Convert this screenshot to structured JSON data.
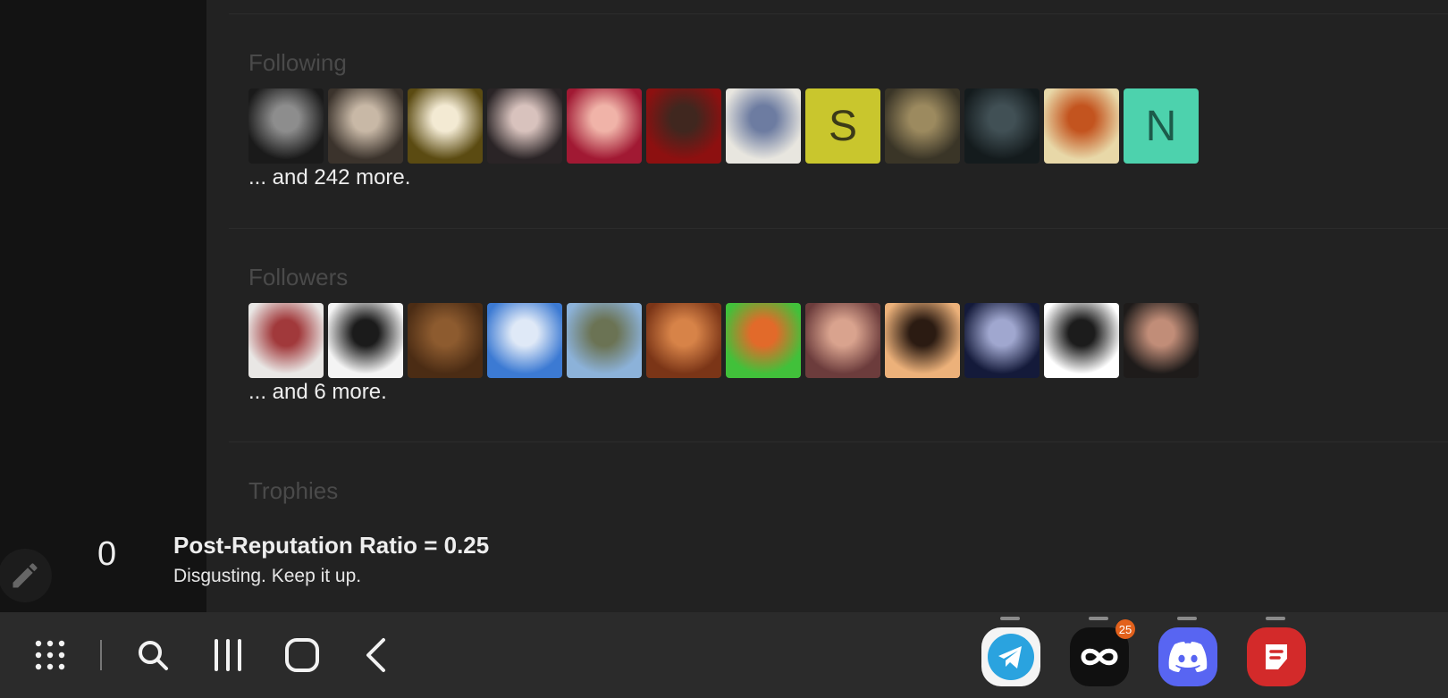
{
  "profile": {
    "following": {
      "title": "Following",
      "more_text": "... and 242 more.",
      "avatars": [
        {
          "name": "avatar-1",
          "type": "photo",
          "colors": [
            "#1a1a1a",
            "#8d8d8d"
          ]
        },
        {
          "name": "avatar-2",
          "type": "photo",
          "colors": [
            "#3b332c",
            "#c8b8a6"
          ]
        },
        {
          "name": "avatar-3",
          "type": "photo",
          "colors": [
            "#5b4b12",
            "#f3ead3"
          ]
        },
        {
          "name": "avatar-4",
          "type": "photo",
          "colors": [
            "#2a2426",
            "#d8c2bd"
          ]
        },
        {
          "name": "avatar-5",
          "type": "photo",
          "colors": [
            "#a11933",
            "#f0b3a8"
          ]
        },
        {
          "name": "avatar-6",
          "type": "photo",
          "colors": [
            "#8d1010",
            "#40271f"
          ]
        },
        {
          "name": "avatar-7",
          "type": "photo",
          "colors": [
            "#e8e6df",
            "#6d7ca1"
          ]
        },
        {
          "name": "avatar-8",
          "type": "letter",
          "letter": "S",
          "bg": "#c9c62d",
          "fg": "#3b3a18"
        },
        {
          "name": "avatar-9",
          "type": "photo",
          "colors": [
            "#3a3527",
            "#9c8a5f"
          ]
        },
        {
          "name": "avatar-10",
          "type": "photo",
          "colors": [
            "#141b1d",
            "#415055"
          ]
        },
        {
          "name": "avatar-11",
          "type": "photo",
          "colors": [
            "#e8d8a8",
            "#c3541f"
          ]
        },
        {
          "name": "avatar-12",
          "type": "letter",
          "letter": "N",
          "bg": "#4dd2ad",
          "fg": "#1c5b4a"
        }
      ]
    },
    "followers": {
      "title": "Followers",
      "more_text": "... and 6 more.",
      "avatars": [
        {
          "name": "avatar-13",
          "type": "photo",
          "colors": [
            "#e9e7e5",
            "#a1393b"
          ]
        },
        {
          "name": "avatar-14",
          "type": "photo",
          "colors": [
            "#f4f4f4",
            "#1b1b1b"
          ]
        },
        {
          "name": "avatar-15",
          "type": "photo",
          "colors": [
            "#4b2c14",
            "#8d5b2f"
          ]
        },
        {
          "name": "avatar-16",
          "type": "photo",
          "colors": [
            "#3c7ad3",
            "#dfe9f7"
          ]
        },
        {
          "name": "avatar-17",
          "type": "photo",
          "colors": [
            "#8cb2d9",
            "#6b7354"
          ]
        },
        {
          "name": "avatar-18",
          "type": "photo",
          "colors": [
            "#7b3517",
            "#d78348"
          ]
        },
        {
          "name": "avatar-19",
          "type": "photo",
          "colors": [
            "#41c13a",
            "#e26a2a"
          ]
        },
        {
          "name": "avatar-20",
          "type": "photo",
          "colors": [
            "#6c3c3c",
            "#d9a38e"
          ]
        },
        {
          "name": "avatar-21",
          "type": "photo",
          "colors": [
            "#ecb17a",
            "#2b1b12"
          ]
        },
        {
          "name": "avatar-22",
          "type": "photo",
          "colors": [
            "#141a3a",
            "#a0a7cf"
          ]
        },
        {
          "name": "avatar-23",
          "type": "photo",
          "colors": [
            "#ffffff",
            "#1c1c1c"
          ]
        },
        {
          "name": "avatar-24",
          "type": "photo",
          "colors": [
            "#1e1b1a",
            "#c18d78"
          ]
        }
      ]
    },
    "trophies": {
      "title": "Trophies",
      "count": "0",
      "name": "Post-Reputation Ratio = 0.25",
      "description": "Disgusting. Keep it up."
    }
  },
  "taskbar": {
    "nav_icons": [
      "apps-grid-icon",
      "search-icon",
      "recent-apps-icon",
      "home-icon",
      "back-icon"
    ],
    "dock": [
      {
        "name": "telegram-app",
        "icon": "telegram-icon",
        "bg": "#ffffff",
        "fg": "#2aa3df"
      },
      {
        "name": "threads-app",
        "icon": "threads-icon",
        "bg": "#121212",
        "fg": "#ffffff",
        "badge": "25"
      },
      {
        "name": "discord-app",
        "icon": "discord-icon",
        "bg": "#5865f2",
        "fg": "#ffffff"
      },
      {
        "name": "notes-app",
        "icon": "notes-icon",
        "bg": "#d62b2b",
        "fg": "#ffffff"
      }
    ]
  },
  "colors": {
    "background": "#222222",
    "sidebar": "#131313",
    "taskbar": "#2b2b2b",
    "section_title": "#4a4a4a",
    "text": "#eeeeee"
  }
}
